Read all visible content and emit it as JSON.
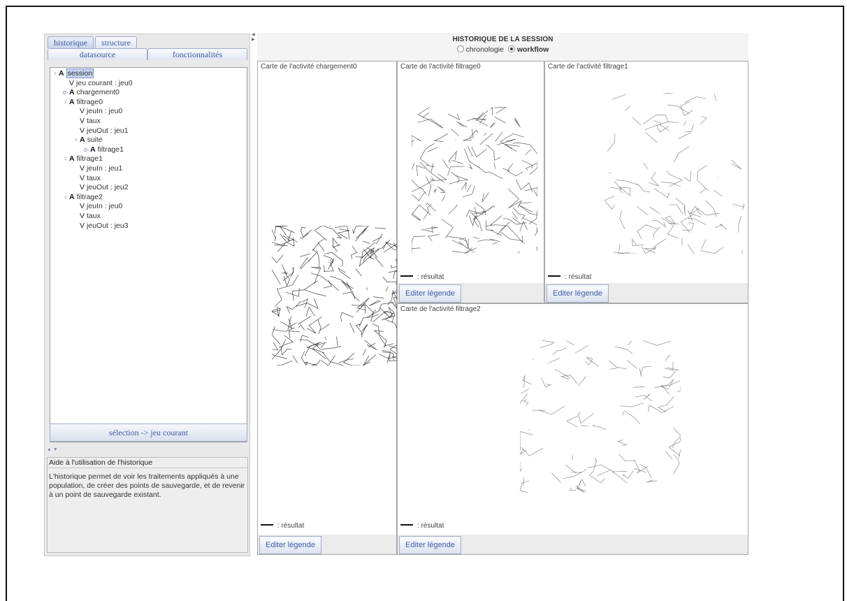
{
  "left_panel": {
    "tabs_top": [
      "historique",
      "structure"
    ],
    "tabs_bottom": [
      "datasource",
      "fonctionnalités"
    ],
    "tree": [
      {
        "level": 0,
        "kind": "A",
        "label": "session",
        "expanded": true,
        "selected": true
      },
      {
        "level": 1,
        "kind": "V",
        "label": "jeu courant : jeu0"
      },
      {
        "level": 1,
        "kind": "A",
        "label": "chargement0",
        "expanded": false
      },
      {
        "level": 1,
        "kind": "A",
        "label": "filtrage0",
        "expanded": true
      },
      {
        "level": 2,
        "kind": "V",
        "label": "jeuIn : jeu0"
      },
      {
        "level": 2,
        "kind": "V",
        "label": "taux"
      },
      {
        "level": 2,
        "kind": "V",
        "label": "jeuOut : jeu1"
      },
      {
        "level": 2,
        "kind": "A",
        "label": "suite",
        "expanded": true
      },
      {
        "level": 3,
        "kind": "A",
        "label": "filtrage1",
        "expanded": false
      },
      {
        "level": 1,
        "kind": "A",
        "label": "filtrage1",
        "expanded": true
      },
      {
        "level": 2,
        "kind": "V",
        "label": "jeuIn : jeu1"
      },
      {
        "level": 2,
        "kind": "V",
        "label": "taux"
      },
      {
        "level": 2,
        "kind": "V",
        "label": "jeuOut : jeu2"
      },
      {
        "level": 1,
        "kind": "A",
        "label": "filtrage2",
        "expanded": true
      },
      {
        "level": 2,
        "kind": "V",
        "label": "jeuIn : jeu0"
      },
      {
        "level": 2,
        "kind": "V",
        "label": "taux"
      },
      {
        "level": 2,
        "kind": "V",
        "label": "jeuOut : jeu3"
      }
    ],
    "selection_button": "sélection -> jeu courant",
    "help_title": "Aide à l'utilisation de l'historique",
    "help_text": "L'historique permet de voir les traitements appliqués à une population, de créer des points de sauvegarde, et de revenir à un point de sauvegarde existant."
  },
  "session": {
    "title": "HISTORIQUE DE LA SESSION",
    "radio_chronologie": "chronologie",
    "radio_workflow": "workflow",
    "selected_view": "workflow"
  },
  "panels": [
    {
      "id": "chargement0",
      "title": "Carte de l'activité chargement0",
      "legend": "résultat",
      "button": "Editer légende"
    },
    {
      "id": "filtrage0",
      "title": "Carte de l'activité filtrage0",
      "legend": "résultat",
      "button": "Editer légende"
    },
    {
      "id": "filtrage1",
      "title": "Carte de l'activité filtrage1",
      "legend": "résultat",
      "button": "Editer légende"
    },
    {
      "id": "filtrage2",
      "title": "Carte de l'activité filtrage2",
      "legend": "résultat",
      "button": "Editer légende"
    }
  ]
}
